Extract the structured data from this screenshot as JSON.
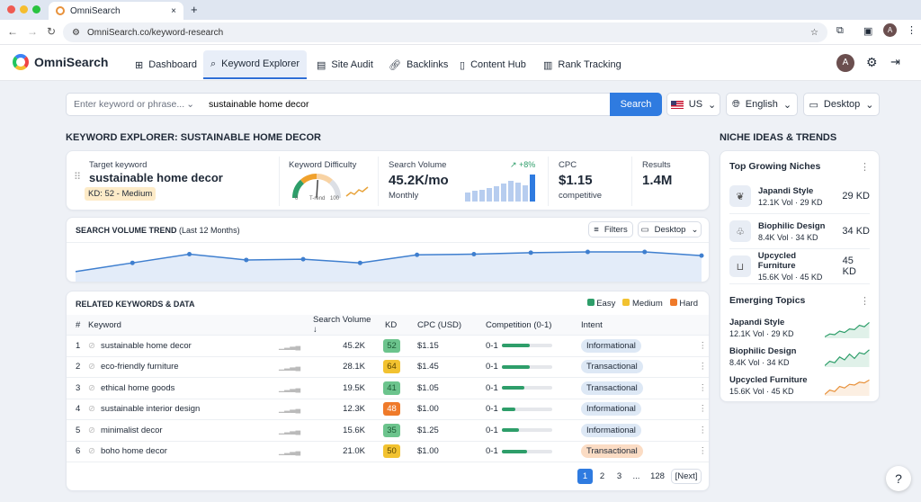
{
  "browser": {
    "tab_title": "OmniSearch",
    "url": "OmniSearch.co/keyword-research",
    "avatar": "A"
  },
  "nav": {
    "logo": "OmniSearch",
    "items": [
      {
        "label": "Dashboard",
        "icon": "grid-icon"
      },
      {
        "label": "Keyword Explorer",
        "icon": "search-icon",
        "active": true
      },
      {
        "label": "Site Audit",
        "icon": "document-icon"
      },
      {
        "label": "Backlinks",
        "icon": "link-icon"
      },
      {
        "label": "Content Hub",
        "icon": "file-icon"
      },
      {
        "label": "Rank Tracking",
        "icon": "bar-chart-icon"
      }
    ],
    "avatar": "A"
  },
  "search": {
    "placeholder": "Enter keyword or phrase...",
    "value": "sustainable home decor",
    "button": "Search",
    "country": "US",
    "language": "English",
    "device": "Desktop"
  },
  "page_title": "KEYWORD EXPLORER: SUSTAINABLE HOME DECOR",
  "metrics": {
    "target_label": "Target keyword",
    "target": "sustainable home decor",
    "kd_badge": "KD: 52 - Medium",
    "kd_label": "Keyword Difficulty",
    "kd_value": 52,
    "gauge_min": "0",
    "gauge_mid": "T-rend",
    "gauge_max": "100",
    "sv_label": "Search Volume",
    "sv_value": "45.2K/mo",
    "sv_sub": "Monthly",
    "sv_change": "↗ +8%",
    "sv_bars": [
      30,
      35,
      40,
      45,
      50,
      60,
      70,
      62,
      55,
      90
    ],
    "cpc_label": "CPC",
    "cpc_value": "$1.15",
    "cpc_sub": "competitive",
    "results_label": "Results",
    "results_value": "1.4M"
  },
  "trend": {
    "title": "SEARCH VOLUME TREND",
    "subtitle": "(Last 12 Months)",
    "filters": "Filters",
    "device": "Desktop",
    "values": [
      30,
      36,
      42,
      38,
      38.5,
      36,
      41.5,
      42,
      43,
      43.5,
      43.5,
      41
    ]
  },
  "table": {
    "title": "RELATED KEYWORDS & DATA",
    "legend": [
      {
        "label": "Easy",
        "color": "#2e9e6a"
      },
      {
        "label": "Medium",
        "color": "#f2c230"
      },
      {
        "label": "Hard",
        "color": "#ef7a2a"
      }
    ],
    "columns": [
      "#",
      "Keyword",
      "Search Volume ↓",
      "KD",
      "CPC (USD)",
      "Competition (0-1)",
      "Intent"
    ],
    "rows": [
      {
        "n": "1",
        "keyword": "sustainable home decor",
        "volume": "45.2K",
        "kd": "52",
        "kd_level": "easy",
        "cpc": "$1.15",
        "comp_label": "0-1",
        "comp": 0.55,
        "intent": "Informational",
        "intent_color": "#dde8f5"
      },
      {
        "n": "2",
        "keyword": "eco-friendly furniture",
        "volume": "28.1K",
        "kd": "64",
        "kd_level": "medium",
        "cpc": "$1.45",
        "comp_label": "0-1",
        "comp": 0.55,
        "intent": "Transactional",
        "intent_color": "#dde8f5"
      },
      {
        "n": "3",
        "keyword": "ethical home goods",
        "volume": "19.5K",
        "kd": "41",
        "kd_level": "easy",
        "cpc": "$1.05",
        "comp_label": "0-1",
        "comp": 0.45,
        "intent": "Transactional",
        "intent_color": "#dde8f5"
      },
      {
        "n": "4",
        "keyword": "sustainable interior design",
        "volume": "12.3K",
        "kd": "48",
        "kd_level": "hard",
        "cpc": "$1.00",
        "comp_label": "0-1",
        "comp": 0.28,
        "intent": "Informational",
        "intent_color": "#dde8f5"
      },
      {
        "n": "5",
        "keyword": "minimalist decor",
        "volume": "15.6K",
        "kd": "35",
        "kd_level": "easy",
        "cpc": "$1.25",
        "comp_label": "0-1",
        "comp": 0.35,
        "intent": "Informational",
        "intent_color": "#dde8f5"
      },
      {
        "n": "6",
        "keyword": "boho home decor",
        "volume": "21.0K",
        "kd": "50",
        "kd_level": "medium",
        "cpc": "$1.00",
        "comp_label": "0-1",
        "comp": 0.5,
        "intent": "Transactional",
        "intent_color": "#fbdcc4"
      }
    ],
    "pages": [
      "1",
      "2",
      "3",
      "...",
      "128"
    ],
    "next": "[Next]"
  },
  "side": {
    "title": "NICHE IDEAS & TRENDS",
    "top_title": "Top Growing Niches",
    "niches": [
      {
        "name": "Japandi Style",
        "sub": "12.1K Vol · 29 KD",
        "kd": "29 KD",
        "icon": "plant-icon"
      },
      {
        "name": "Biophilic Design",
        "sub": "8.4K Vol · 34 KD",
        "kd": "34 KD",
        "icon": "tree-icon"
      },
      {
        "name": "Upcycled Furniture",
        "sub": "15.6K Vol · 45 KD",
        "kd": "45 KD",
        "icon": "sofa-icon"
      }
    ],
    "emerging_title": "Emerging Topics",
    "emerging": [
      {
        "name": "Japandi Style",
        "sub": "12.1K Vol · 29 KD",
        "color": "#2e9e6a"
      },
      {
        "name": "Biophilic Design",
        "sub": "8.4K Vol · 34 KD",
        "color": "#2e9e6a"
      },
      {
        "name": "Upcycled Furniture",
        "sub": "15.6K Vol · 45 KD",
        "color": "#e8913a"
      }
    ]
  },
  "help": "?"
}
